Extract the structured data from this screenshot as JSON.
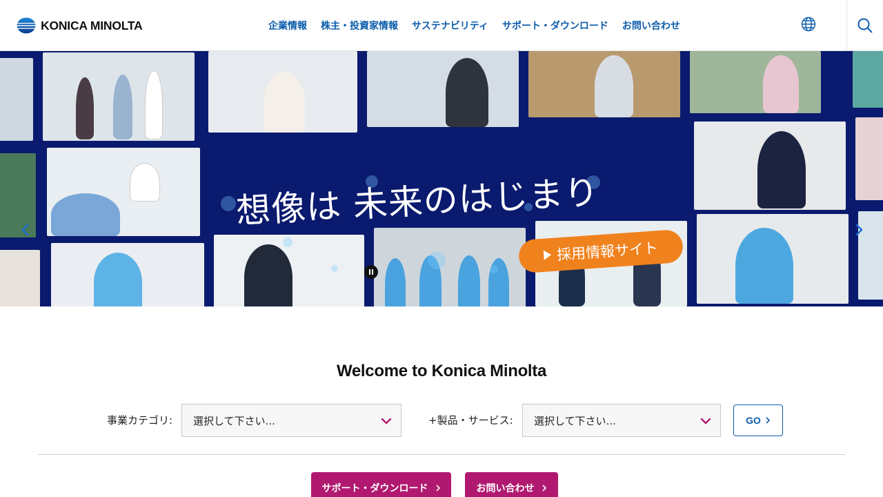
{
  "header": {
    "logo_text": "KONICA MINOLTA",
    "nav": [
      {
        "label": "企業情報"
      },
      {
        "label": "株主・投資家情報"
      },
      {
        "label": "サステナビリティ"
      },
      {
        "label": "サポート・ダウンロード"
      },
      {
        "label": "お問い合わせ"
      }
    ],
    "globe_icon": "globe-icon",
    "search_icon": "search-icon"
  },
  "hero": {
    "headline_part1": "想像は",
    "headline_part2": "未来のはじまり",
    "cta_label": "採用情報サイト",
    "prev_icon": "chevron-left-icon",
    "next_icon": "chevron-right-icon",
    "pause_icon": "pause-icon"
  },
  "welcome": {
    "title": "Welcome to Konica Minolta",
    "category_label": "事業カテゴリ:",
    "category_value": "選択して下さい...",
    "product_label": "+製品・サービス:",
    "product_value": "選択して下さい...",
    "go_label": "GO"
  },
  "quick_links": {
    "support_label": "サポート・ダウンロード",
    "contact_label": "お問い合わせ"
  },
  "colors": {
    "brand_blue": "#0b5cab",
    "hero_navy": "#0a1a6e",
    "cta_orange": "#f0821e",
    "accent_magenta": "#b0196f"
  }
}
